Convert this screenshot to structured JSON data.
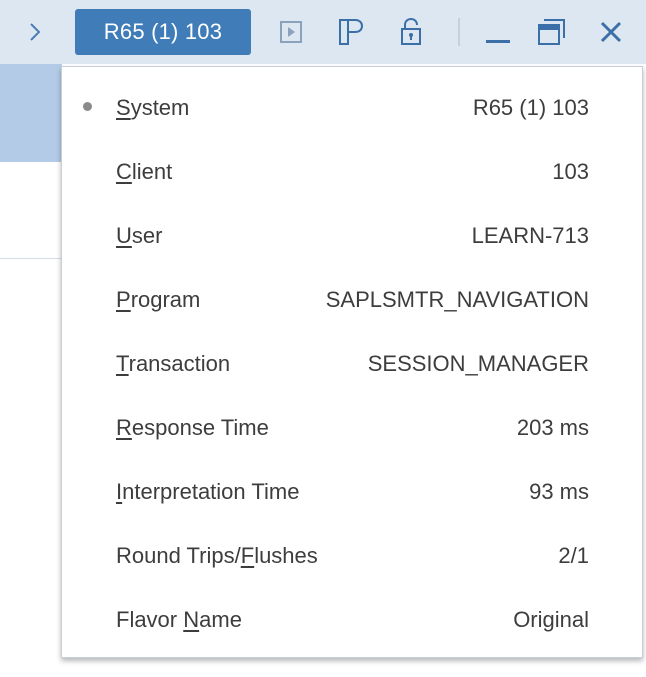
{
  "titlebar": {
    "system_button": "R65 (1) 103",
    "icons": [
      "chevron-right-icon",
      "play-icon",
      "layout-icon",
      "unlock-icon",
      "minimize-icon",
      "restore-icon",
      "close-icon"
    ]
  },
  "colors": {
    "titlebar_bg": "#dde7f2",
    "accent": "#3f7cb8",
    "icon": "#3a6fa8",
    "text": "#3d3d3d"
  },
  "status_menu": {
    "items": [
      {
        "pre": "",
        "mnemonic": "S",
        "post": "ystem",
        "value": "R65 (1) 103",
        "selected": true
      },
      {
        "pre": "",
        "mnemonic": "C",
        "post": "lient",
        "value": "103",
        "selected": false
      },
      {
        "pre": "",
        "mnemonic": "U",
        "post": "ser",
        "value": "LEARN-713",
        "selected": false
      },
      {
        "pre": "",
        "mnemonic": "P",
        "post": "rogram",
        "value": "SAPLSMTR_NAVIGATION",
        "selected": false
      },
      {
        "pre": "",
        "mnemonic": "T",
        "post": "ransaction",
        "value": "SESSION_MANAGER",
        "selected": false
      },
      {
        "pre": "",
        "mnemonic": "R",
        "post": "esponse Time",
        "value": "203 ms",
        "selected": false
      },
      {
        "pre": "",
        "mnemonic": "I",
        "post": "nterpretation Time",
        "value": "93 ms",
        "selected": false
      },
      {
        "pre": "Round Trips/",
        "mnemonic": "F",
        "post": "lushes",
        "value": "2/1",
        "selected": false
      },
      {
        "pre": "Flavor ",
        "mnemonic": "N",
        "post": "ame",
        "value": "Original",
        "selected": false
      }
    ]
  }
}
